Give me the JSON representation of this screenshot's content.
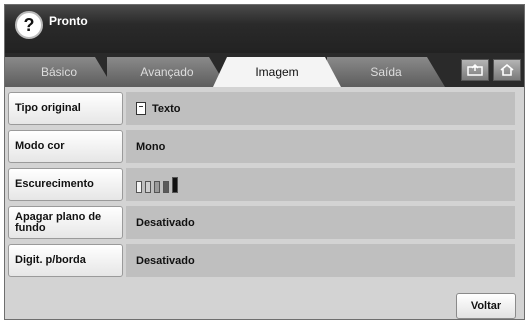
{
  "header": {
    "status": "Pronto",
    "help_icon": "help-icon"
  },
  "tabs": [
    {
      "label": "Básico",
      "active": false
    },
    {
      "label": "Avançado",
      "active": false
    },
    {
      "label": "Imagem",
      "active": true
    },
    {
      "label": "Saída",
      "active": false
    }
  ],
  "toolbar": {
    "icons": [
      "job-status-icon",
      "home-icon"
    ]
  },
  "settings": [
    {
      "label": "Tipo original",
      "value": "Texto",
      "icon": "document-icon"
    },
    {
      "label": "Modo cor",
      "value": "Mono"
    },
    {
      "label": "Escurecimento",
      "value": "",
      "level": 5,
      "level_max": 5
    },
    {
      "label": "Apagar plano de fundo",
      "value": "Desativado"
    },
    {
      "label": "Digit. p/borda",
      "value": "Desativado"
    }
  ],
  "back_button": "Voltar"
}
